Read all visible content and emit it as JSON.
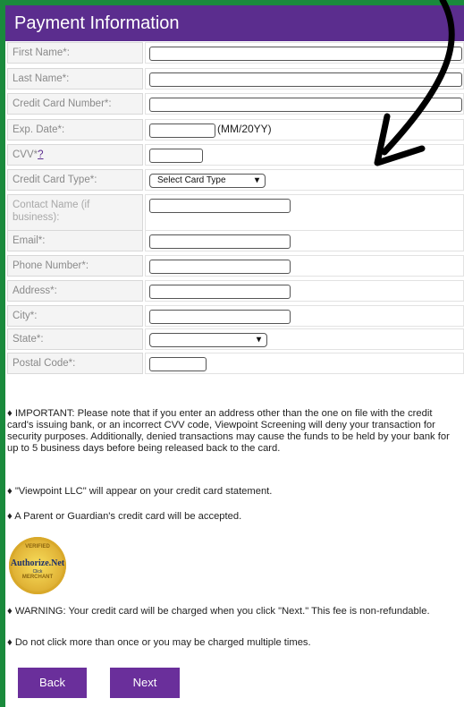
{
  "header": {
    "title": "Payment Information"
  },
  "form": {
    "rows": [
      {
        "label": "First Name*:"
      },
      {
        "label": "Last Name*:"
      },
      {
        "label": "Credit Card Number*:"
      },
      {
        "label": "Exp. Date*:",
        "hint": "(MM/20YY)"
      },
      {
        "label": "CVV*",
        "link": "?"
      },
      {
        "label": "Credit Card Type*:",
        "select_value": "Select Card Type"
      },
      {
        "label": "Contact Name (if business):"
      },
      {
        "label": "Email*:"
      },
      {
        "label": "Phone Number*:"
      },
      {
        "label": "Address*:"
      },
      {
        "label": "City*:"
      },
      {
        "label": "State*:"
      },
      {
        "label": "Postal Code*:"
      }
    ]
  },
  "notes": {
    "important": "♦ IMPORTANT: Please note that if you enter an address other than the one on file with the credit card's issuing bank, or an incorrect CVV code, Viewpoint Screening will deny your transaction for security purposes. Additionally, denied transactions may cause the funds to be held by your bank for up to 5 business days before being released back to the card.",
    "statement": "♦ \"Viewpoint LLC\" will appear on your credit card statement.",
    "guardian": "♦ A Parent or Guardian's credit card will be accepted.",
    "warning": "♦ WARNING: Your credit card will be charged when you click \"Next.\" This fee is non-refundable.",
    "multiple": "♦ Do not click more than once or you may be charged multiple times."
  },
  "logo": {
    "top": "VERIFIED",
    "name": "Authorize.Net",
    "click": "Click",
    "bottom": "MERCHANT"
  },
  "buttons": {
    "back": "Back",
    "next": "Next"
  },
  "colors": {
    "header": "#5b2d8e",
    "button": "#6a2f9b",
    "frame": "#1a8a3c"
  }
}
